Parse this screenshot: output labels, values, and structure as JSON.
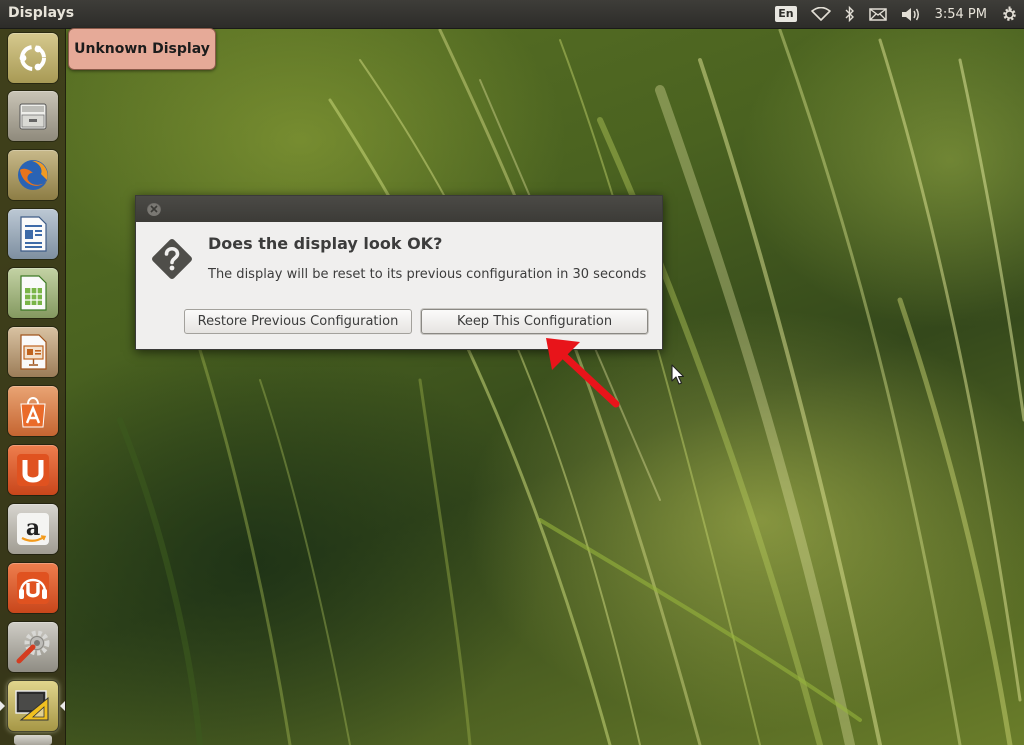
{
  "panel": {
    "title": "Displays",
    "language": "En",
    "clock": "3:54 PM",
    "icons": [
      "network-wireless-icon",
      "bluetooth-icon",
      "mail-envelope-icon",
      "volume-icon",
      "settings-gear-icon"
    ]
  },
  "launcher": {
    "items": [
      {
        "name": "dash-home-button",
        "icon": "ubuntu-logo-icon"
      },
      {
        "name": "files-button",
        "icon": "file-cabinet-icon"
      },
      {
        "name": "firefox-button",
        "icon": "firefox-icon"
      },
      {
        "name": "libreoffice-writer-button",
        "icon": "writer-document-icon"
      },
      {
        "name": "libreoffice-calc-button",
        "icon": "calc-spreadsheet-icon"
      },
      {
        "name": "libreoffice-impress-button",
        "icon": "impress-presentation-icon"
      },
      {
        "name": "software-center-button",
        "icon": "shopping-bag-icon"
      },
      {
        "name": "ubuntu-one-button",
        "icon": "ubuntu-one-icon"
      },
      {
        "name": "amazon-button",
        "icon": "amazon-icon"
      },
      {
        "name": "ubuntu-one-music-button",
        "icon": "headphones-icon"
      },
      {
        "name": "system-settings-button",
        "icon": "wrench-gear-icon"
      },
      {
        "name": "displays-button",
        "icon": "display-ruler-icon"
      }
    ]
  },
  "tooltip": {
    "text": "Unknown Display"
  },
  "dialog": {
    "heading": "Does the display look OK?",
    "message": "The display will be reset to its previous configuration in 30 seconds",
    "restore_label": "Restore Previous Configuration",
    "keep_label": "Keep This Configuration"
  },
  "colors": {
    "panel": "#3e3d39",
    "tooltip": "#e6aa98",
    "dialog_bg": "#f0efee",
    "annotation_arrow": "#e8141a"
  }
}
